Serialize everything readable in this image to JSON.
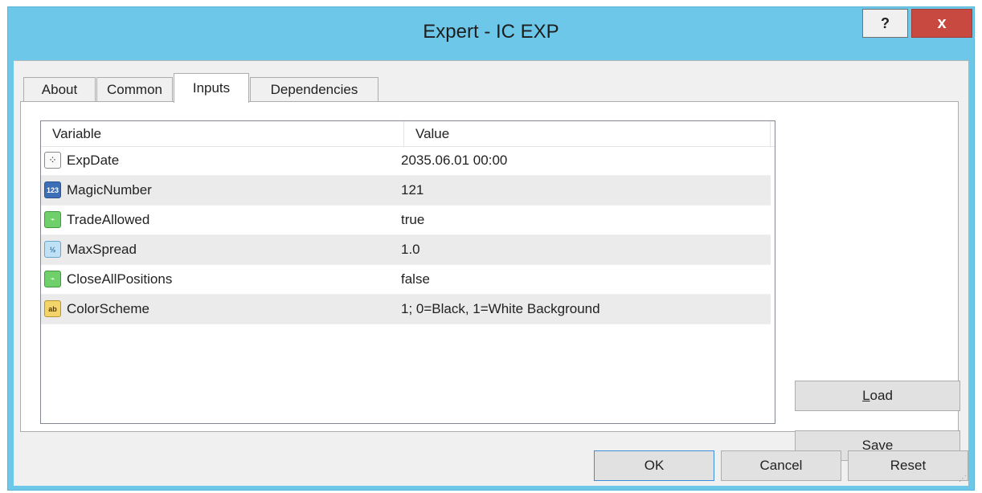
{
  "window": {
    "title": "Expert - IC EXP",
    "help_label": "?",
    "close_label": "x"
  },
  "tabs": [
    {
      "label": "About"
    },
    {
      "label": "Common"
    },
    {
      "label": "Inputs"
    },
    {
      "label": "Dependencies"
    }
  ],
  "active_tab": "Inputs",
  "grid": {
    "columns": [
      "Variable",
      "Value"
    ],
    "rows": [
      {
        "icon": "datetime-icon",
        "icon_glyph": "⁘",
        "variable": "ExpDate",
        "value": "2035.06.01 00:00"
      },
      {
        "icon": "integer-icon",
        "icon_glyph": "123",
        "variable": "MagicNumber",
        "value": "121"
      },
      {
        "icon": "bool-icon",
        "icon_glyph": "⌁",
        "variable": "TradeAllowed",
        "value": "true"
      },
      {
        "icon": "double-icon",
        "icon_glyph": "½",
        "variable": "MaxSpread",
        "value": "1.0"
      },
      {
        "icon": "bool-icon",
        "icon_glyph": "⌁",
        "variable": "CloseAllPositions",
        "value": "false"
      },
      {
        "icon": "string-icon",
        "icon_glyph": "ab",
        "variable": "ColorScheme",
        "value": "1; 0=Black, 1=White Background"
      }
    ]
  },
  "buttons": {
    "load_mnemonic": "L",
    "load_rest": "oad",
    "save_mnemonic": "S",
    "save_rest": "ave",
    "ok": "OK",
    "cancel": "Cancel",
    "reset": "Reset"
  },
  "colors": {
    "titlebar": "#6cc7e8",
    "close": "#c7493f",
    "ok_border": "#3c8fd6"
  }
}
